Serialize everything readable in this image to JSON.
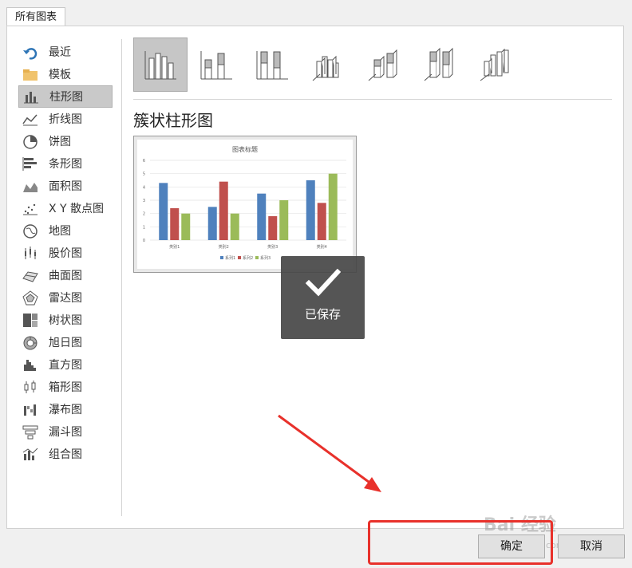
{
  "tab": {
    "label": "所有图表"
  },
  "sidebar": {
    "items": [
      {
        "label": "最近",
        "icon": "undo-icon"
      },
      {
        "label": "模板",
        "icon": "folder-icon"
      },
      {
        "label": "柱形图",
        "icon": "column-chart-icon",
        "selected": true
      },
      {
        "label": "折线图",
        "icon": "line-chart-icon"
      },
      {
        "label": "饼图",
        "icon": "pie-chart-icon"
      },
      {
        "label": "条形图",
        "icon": "bar-chart-icon"
      },
      {
        "label": "面积图",
        "icon": "area-chart-icon"
      },
      {
        "label": "X Y 散点图",
        "icon": "scatter-chart-icon"
      },
      {
        "label": "地图",
        "icon": "map-chart-icon"
      },
      {
        "label": "股价图",
        "icon": "stock-chart-icon"
      },
      {
        "label": "曲面图",
        "icon": "surface-chart-icon"
      },
      {
        "label": "雷达图",
        "icon": "radar-chart-icon"
      },
      {
        "label": "树状图",
        "icon": "treemap-chart-icon"
      },
      {
        "label": "旭日图",
        "icon": "sunburst-chart-icon"
      },
      {
        "label": "直方图",
        "icon": "histogram-chart-icon"
      },
      {
        "label": "箱形图",
        "icon": "box-whisker-chart-icon"
      },
      {
        "label": "瀑布图",
        "icon": "waterfall-chart-icon"
      },
      {
        "label": "漏斗图",
        "icon": "funnel-chart-icon"
      },
      {
        "label": "组合图",
        "icon": "combo-chart-icon"
      }
    ]
  },
  "main": {
    "subtype_title": "簇状柱形图",
    "preview_chart_title": "图表标题",
    "toast_text": "已保存"
  },
  "chart_data": {
    "type": "bar",
    "title": "图表标题",
    "categories": [
      "类别1",
      "类别2",
      "类别3",
      "类别4"
    ],
    "series": [
      {
        "name": "系列1",
        "values": [
          4.3,
          2.5,
          3.5,
          4.5
        ],
        "color": "#4f81bd"
      },
      {
        "name": "系列2",
        "values": [
          2.4,
          4.4,
          1.8,
          2.8
        ],
        "color": "#c0504d"
      },
      {
        "name": "系列3",
        "values": [
          2,
          2,
          3,
          5
        ],
        "color": "#9bbb59"
      }
    ],
    "ylim": [
      0,
      6
    ],
    "yticks": [
      "0",
      "1",
      "2",
      "3",
      "4",
      "5",
      "6"
    ],
    "grid": true,
    "legend": "bottom"
  },
  "footer": {
    "ok_label": "确定",
    "cancel_label": "取消"
  },
  "watermark": {
    "logo": "Bai 经验",
    "url": "jingyan.baidu.com"
  },
  "colors": {
    "annotation_red": "#e8312b",
    "selected_gray": "#c9c9c9"
  }
}
